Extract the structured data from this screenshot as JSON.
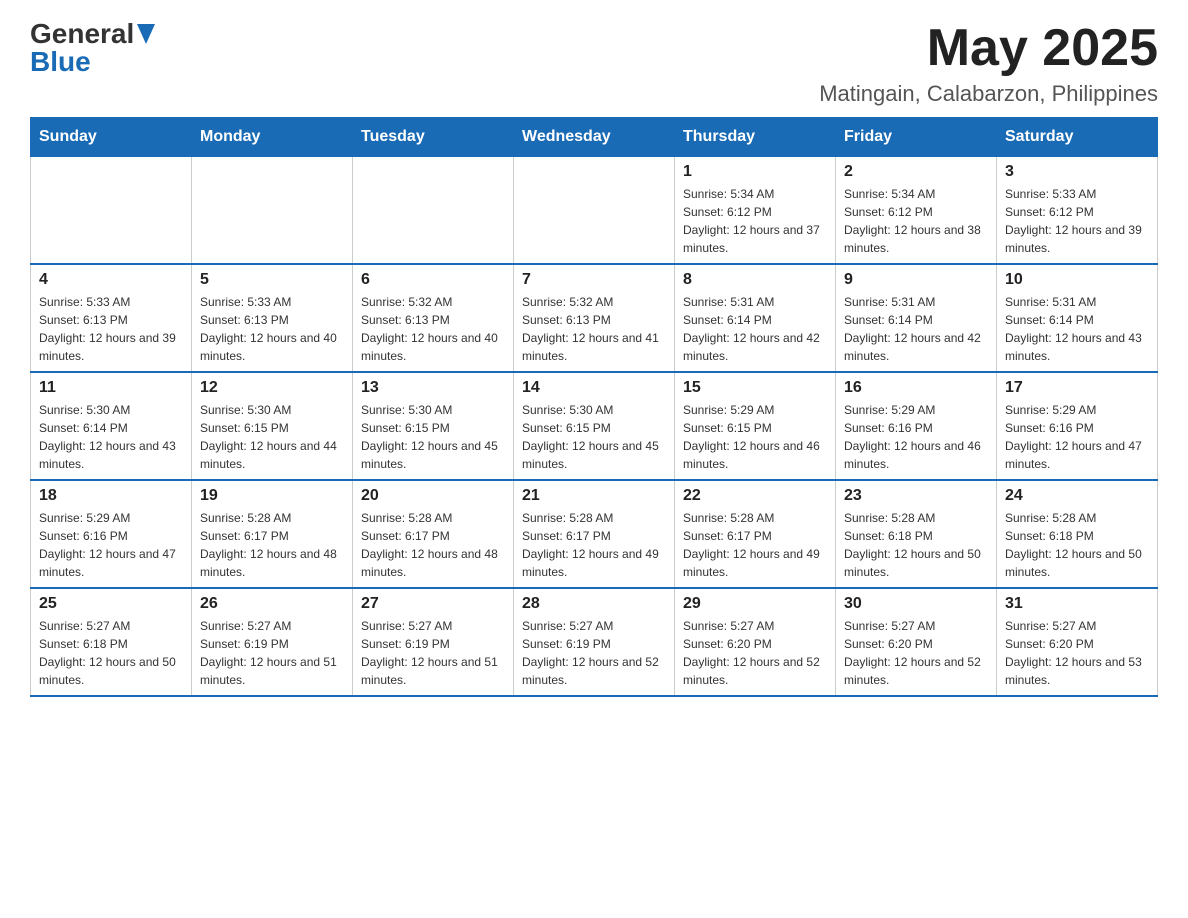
{
  "header": {
    "logo_general": "General",
    "logo_blue": "Blue",
    "month_year": "May 2025",
    "location": "Matingain, Calabarzon, Philippines"
  },
  "weekdays": [
    "Sunday",
    "Monday",
    "Tuesday",
    "Wednesday",
    "Thursday",
    "Friday",
    "Saturday"
  ],
  "weeks": [
    {
      "days": [
        {
          "num": "",
          "info": ""
        },
        {
          "num": "",
          "info": ""
        },
        {
          "num": "",
          "info": ""
        },
        {
          "num": "",
          "info": ""
        },
        {
          "num": "1",
          "info": "Sunrise: 5:34 AM\nSunset: 6:12 PM\nDaylight: 12 hours and 37 minutes."
        },
        {
          "num": "2",
          "info": "Sunrise: 5:34 AM\nSunset: 6:12 PM\nDaylight: 12 hours and 38 minutes."
        },
        {
          "num": "3",
          "info": "Sunrise: 5:33 AM\nSunset: 6:12 PM\nDaylight: 12 hours and 39 minutes."
        }
      ]
    },
    {
      "days": [
        {
          "num": "4",
          "info": "Sunrise: 5:33 AM\nSunset: 6:13 PM\nDaylight: 12 hours and 39 minutes."
        },
        {
          "num": "5",
          "info": "Sunrise: 5:33 AM\nSunset: 6:13 PM\nDaylight: 12 hours and 40 minutes."
        },
        {
          "num": "6",
          "info": "Sunrise: 5:32 AM\nSunset: 6:13 PM\nDaylight: 12 hours and 40 minutes."
        },
        {
          "num": "7",
          "info": "Sunrise: 5:32 AM\nSunset: 6:13 PM\nDaylight: 12 hours and 41 minutes."
        },
        {
          "num": "8",
          "info": "Sunrise: 5:31 AM\nSunset: 6:14 PM\nDaylight: 12 hours and 42 minutes."
        },
        {
          "num": "9",
          "info": "Sunrise: 5:31 AM\nSunset: 6:14 PM\nDaylight: 12 hours and 42 minutes."
        },
        {
          "num": "10",
          "info": "Sunrise: 5:31 AM\nSunset: 6:14 PM\nDaylight: 12 hours and 43 minutes."
        }
      ]
    },
    {
      "days": [
        {
          "num": "11",
          "info": "Sunrise: 5:30 AM\nSunset: 6:14 PM\nDaylight: 12 hours and 43 minutes."
        },
        {
          "num": "12",
          "info": "Sunrise: 5:30 AM\nSunset: 6:15 PM\nDaylight: 12 hours and 44 minutes."
        },
        {
          "num": "13",
          "info": "Sunrise: 5:30 AM\nSunset: 6:15 PM\nDaylight: 12 hours and 45 minutes."
        },
        {
          "num": "14",
          "info": "Sunrise: 5:30 AM\nSunset: 6:15 PM\nDaylight: 12 hours and 45 minutes."
        },
        {
          "num": "15",
          "info": "Sunrise: 5:29 AM\nSunset: 6:15 PM\nDaylight: 12 hours and 46 minutes."
        },
        {
          "num": "16",
          "info": "Sunrise: 5:29 AM\nSunset: 6:16 PM\nDaylight: 12 hours and 46 minutes."
        },
        {
          "num": "17",
          "info": "Sunrise: 5:29 AM\nSunset: 6:16 PM\nDaylight: 12 hours and 47 minutes."
        }
      ]
    },
    {
      "days": [
        {
          "num": "18",
          "info": "Sunrise: 5:29 AM\nSunset: 6:16 PM\nDaylight: 12 hours and 47 minutes."
        },
        {
          "num": "19",
          "info": "Sunrise: 5:28 AM\nSunset: 6:17 PM\nDaylight: 12 hours and 48 minutes."
        },
        {
          "num": "20",
          "info": "Sunrise: 5:28 AM\nSunset: 6:17 PM\nDaylight: 12 hours and 48 minutes."
        },
        {
          "num": "21",
          "info": "Sunrise: 5:28 AM\nSunset: 6:17 PM\nDaylight: 12 hours and 49 minutes."
        },
        {
          "num": "22",
          "info": "Sunrise: 5:28 AM\nSunset: 6:17 PM\nDaylight: 12 hours and 49 minutes."
        },
        {
          "num": "23",
          "info": "Sunrise: 5:28 AM\nSunset: 6:18 PM\nDaylight: 12 hours and 50 minutes."
        },
        {
          "num": "24",
          "info": "Sunrise: 5:28 AM\nSunset: 6:18 PM\nDaylight: 12 hours and 50 minutes."
        }
      ]
    },
    {
      "days": [
        {
          "num": "25",
          "info": "Sunrise: 5:27 AM\nSunset: 6:18 PM\nDaylight: 12 hours and 50 minutes."
        },
        {
          "num": "26",
          "info": "Sunrise: 5:27 AM\nSunset: 6:19 PM\nDaylight: 12 hours and 51 minutes."
        },
        {
          "num": "27",
          "info": "Sunrise: 5:27 AM\nSunset: 6:19 PM\nDaylight: 12 hours and 51 minutes."
        },
        {
          "num": "28",
          "info": "Sunrise: 5:27 AM\nSunset: 6:19 PM\nDaylight: 12 hours and 52 minutes."
        },
        {
          "num": "29",
          "info": "Sunrise: 5:27 AM\nSunset: 6:20 PM\nDaylight: 12 hours and 52 minutes."
        },
        {
          "num": "30",
          "info": "Sunrise: 5:27 AM\nSunset: 6:20 PM\nDaylight: 12 hours and 52 minutes."
        },
        {
          "num": "31",
          "info": "Sunrise: 5:27 AM\nSunset: 6:20 PM\nDaylight: 12 hours and 53 minutes."
        }
      ]
    }
  ]
}
